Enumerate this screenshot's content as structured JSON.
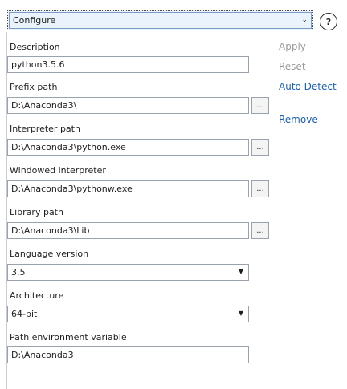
{
  "header": {
    "configure_select": "Configure",
    "help_label": "?"
  },
  "actions": {
    "apply": "Apply",
    "reset": "Reset",
    "auto_detect": "Auto Detect",
    "remove": "Remove"
  },
  "fields": {
    "description": {
      "label": "Description",
      "value": "python3.5.6"
    },
    "prefix_path": {
      "label": "Prefix path",
      "value": "D:\\Anaconda3\\"
    },
    "interpreter_path": {
      "label": "Interpreter path",
      "value": "D:\\Anaconda3\\python.exe"
    },
    "windowed_interpreter": {
      "label": "Windowed interpreter",
      "value": "D:\\Anaconda3\\pythonw.exe"
    },
    "library_path": {
      "label": "Library path",
      "value": "D:\\Anaconda3\\Lib"
    },
    "language_version": {
      "label": "Language version",
      "value": "3.5"
    },
    "architecture": {
      "label": "Architecture",
      "value": "64-bit"
    },
    "path_env_var": {
      "label": "Path environment variable",
      "value": "D:\\Anaconda3"
    }
  },
  "browse_label": "...",
  "colors": {
    "link": "#1a5fb4",
    "disabled": "#9b9b9b",
    "select_bg": "#eaf2fb"
  }
}
